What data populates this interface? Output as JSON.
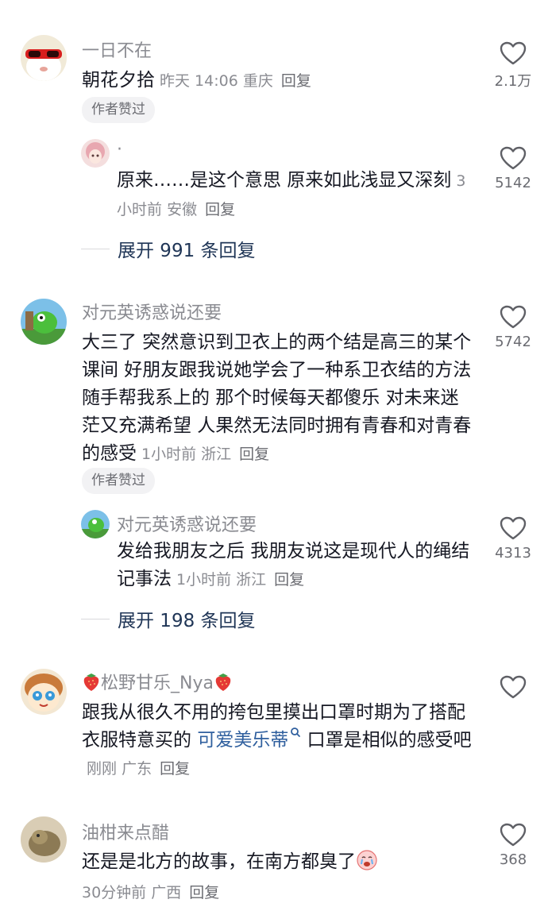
{
  "comments": [
    {
      "user": "一日不在",
      "text": "朝花夕拾",
      "time": "昨天 14:06",
      "location": "重庆",
      "reply_label": "回复",
      "likes": "2.1万",
      "badge": "作者赞过"
    },
    {
      "user": "对元英诱惑说还要",
      "text": "大三了 突然意识到卫衣上的两个结是高三的某个课间 好朋友跟我说她学会了一种系卫衣结的方法 随手帮我系上的 那个时候每天都傻乐 对未来迷茫又充满希望 人果然无法同时拥有青春和对青春的感受",
      "time": "1小时前",
      "location": "浙江",
      "reply_label": "回复",
      "likes": "5742",
      "badge": "作者赞过"
    },
    {
      "user": "松野甘乐_Nya",
      "text_before": "跟我从很久不用的挎包里摸出口罩时期为了搭配衣服特意买的",
      "link_text": "可爱美乐蒂",
      "text_after": "口罩是相似的感受吧",
      "time": "刚刚",
      "location": "广东",
      "reply_label": "回复",
      "likes": ""
    },
    {
      "user": "油柑来点醋",
      "text": "还是是北方的故事，在南方都臭了",
      "time": "30分钟前",
      "location": "广西",
      "reply_label": "回复",
      "likes": "368"
    }
  ],
  "replies": [
    {
      "user": "·",
      "text": "原来……是这个意思 原来如此浅显又深刻",
      "time": "3小时前",
      "location": "安徽",
      "reply_label": "回复",
      "likes": "5142"
    },
    {
      "user": "对元英诱惑说还要",
      "text": "发给我朋友之后 我朋友说这是现代人的绳结记事法",
      "time": "1小时前",
      "location": "浙江",
      "reply_label": "回复",
      "likes": "4313"
    }
  ],
  "expand": [
    {
      "label": "展开 991 条回复"
    },
    {
      "label": "展开 198 条回复"
    }
  ],
  "colors": {
    "username": "#8a8b91",
    "text": "#161823",
    "link": "#2f5f9e",
    "expand": "#1f3556"
  }
}
